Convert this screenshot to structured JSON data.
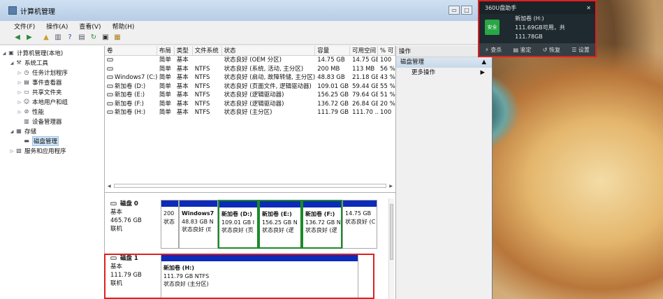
{
  "window": {
    "title": "计算机管理",
    "buttons": [
      "▭",
      "□",
      "✕"
    ]
  },
  "menu": [
    "文件(F)",
    "操作(A)",
    "查看(V)",
    "帮助(H)"
  ],
  "tree": [
    {
      "label": "计算机管理(本地)",
      "indent": 0,
      "tri": "◢",
      "icon": "computer-icon"
    },
    {
      "label": "系统工具",
      "indent": 1,
      "tri": "◢",
      "icon": "tools-icon"
    },
    {
      "label": "任务计划程序",
      "indent": 2,
      "tri": "▷",
      "icon": "clock-icon"
    },
    {
      "label": "事件查看器",
      "indent": 2,
      "tri": "▷",
      "icon": "event-viewer-icon"
    },
    {
      "label": "共享文件夹",
      "indent": 2,
      "tri": "▷",
      "icon": "folder-icon"
    },
    {
      "label": "本地用户和组",
      "indent": 2,
      "tri": "▷",
      "icon": "users-icon"
    },
    {
      "label": "性能",
      "indent": 2,
      "tri": "▷",
      "icon": "performance-icon"
    },
    {
      "label": "设备管理器",
      "indent": 2,
      "tri": "",
      "icon": "device-manager-icon"
    },
    {
      "label": "存储",
      "indent": 1,
      "tri": "◢",
      "icon": "storage-icon"
    },
    {
      "label": "磁盘管理",
      "indent": 2,
      "tri": "",
      "icon": "disk-management-icon",
      "selected": true
    },
    {
      "label": "服务和应用程序",
      "indent": 1,
      "tri": "▷",
      "icon": "services-icon"
    }
  ],
  "volume_table": {
    "headers": [
      "卷",
      "布局",
      "类型",
      "文件系统",
      "状态",
      "容量",
      "可用空间",
      "% 可"
    ],
    "rows": [
      [
        "",
        "简单",
        "基本",
        "",
        "状态良好 (OEM 分区)",
        "14.75 GB",
        "14.75 GB",
        "100"
      ],
      [
        "",
        "简单",
        "基本",
        "NTFS",
        "状态良好 (系统, 活动, 主分区)",
        "200 MB",
        "113 MB",
        "56 %"
      ],
      [
        "Windows7 (C:)",
        "简单",
        "基本",
        "NTFS",
        "状态良好 (启动, 故障转储, 主分区)",
        "48.83 GB",
        "21.18 GB",
        "43 %"
      ],
      [
        "新加卷 (D:)",
        "简单",
        "基本",
        "NTFS",
        "状态良好 (页面文件, 逻辑驱动器)",
        "109.01 GB",
        "59.44 GB",
        "55 %"
      ],
      [
        "新加卷 (E:)",
        "简单",
        "基本",
        "NTFS",
        "状态良好 (逻辑驱动器)",
        "156.25 GB",
        "79.64 GB",
        "51 %"
      ],
      [
        "新加卷 (F:)",
        "简单",
        "基本",
        "NTFS",
        "状态良好 (逻辑驱动器)",
        "136.72 GB",
        "26.84 GB",
        "20 %"
      ],
      [
        "新加卷 (H:)",
        "简单",
        "基本",
        "NTFS",
        "状态良好 (主分区)",
        "111.79 GB",
        "111.70 ...",
        "100"
      ]
    ]
  },
  "disks": [
    {
      "name": "磁盘 0",
      "type": "基本",
      "size": "465.76 GB",
      "status": "联机",
      "partitions": [
        {
          "name": "",
          "line1": "200",
          "line2": "状态",
          "green": false
        },
        {
          "name": "Windows7",
          "line1": "48.83 GB N",
          "line2": "状态良好 (E",
          "green": false
        },
        {
          "name": "新加卷 (D:)",
          "line1": "109.01 GB I",
          "line2": "状态良好 (页",
          "green": true
        },
        {
          "name": "新加卷 (E:)",
          "line1": "156.25 GB N",
          "line2": "状态良好 (逻",
          "green": true
        },
        {
          "name": "新加卷 (F:)",
          "line1": "136.72 GB N",
          "line2": "状态良好 (逻",
          "green": true
        },
        {
          "name": "",
          "line1": "14.75 GB",
          "line2": "状态良好 (C",
          "green": false
        }
      ]
    },
    {
      "name": "磁盘 1",
      "type": "基本",
      "size": "111.79 GB",
      "status": "联机",
      "partitions": [
        {
          "name": "新加卷 (H:)",
          "line1": "111.79 GB NTFS",
          "line2": "状态良好 (主分区)",
          "green": false
        }
      ]
    }
  ],
  "actions": {
    "header": "操作",
    "section": "磁盘管理",
    "more": "更多操作"
  },
  "popup": {
    "title": "360U盘助手",
    "safe_label": "安全",
    "volume": "新加卷 (H:)",
    "info": "111.69GB可用，共111.78GB",
    "buttons": [
      "查杀",
      "鉴定",
      "恢复",
      "设置"
    ]
  },
  "colors": {
    "partition_bar": "#0d2ab8",
    "highlight_red": "#e01f1f",
    "highlight_green": "#1a8a2a"
  }
}
